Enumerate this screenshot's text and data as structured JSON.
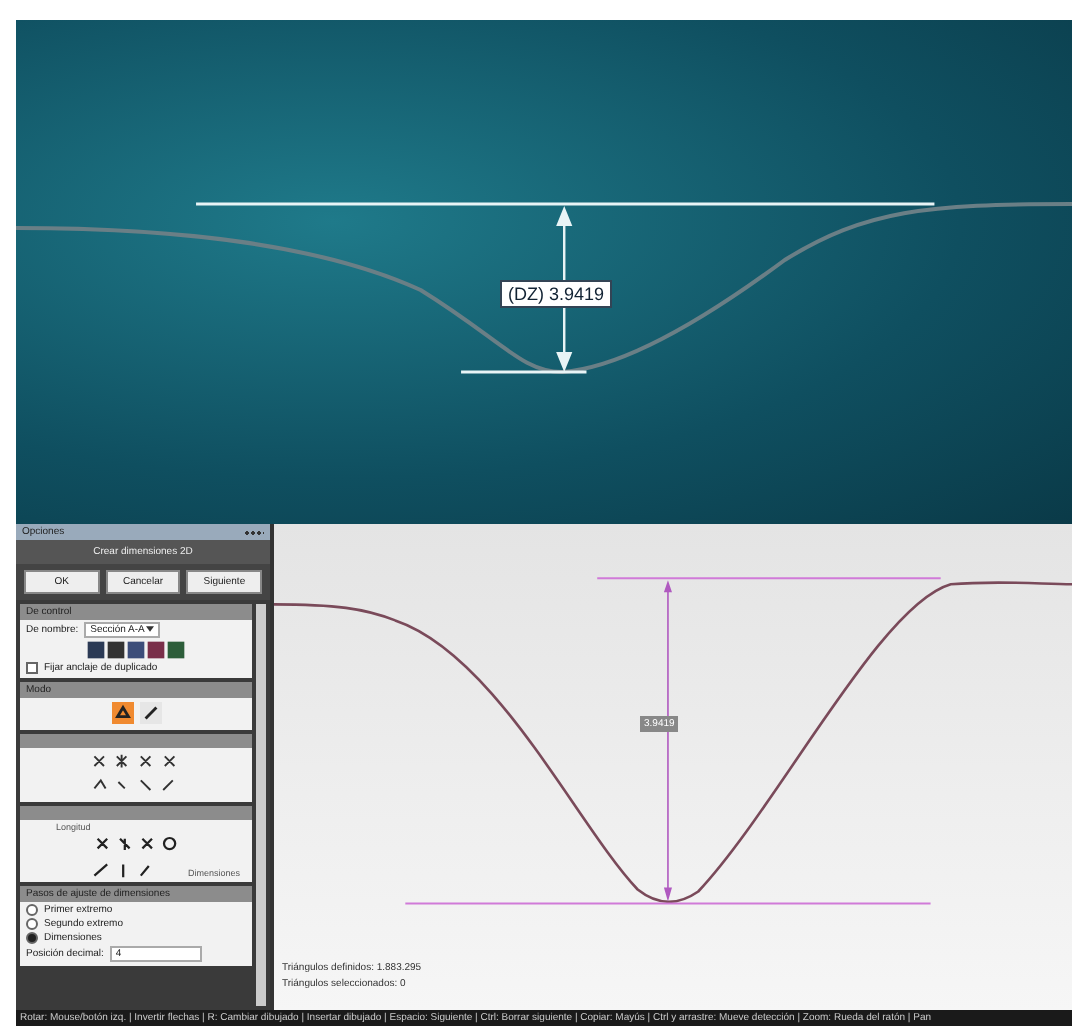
{
  "viewport_3d": {
    "dimension_label": "(DZ) 3.9419"
  },
  "side_panel": {
    "title": "Opciones",
    "header": "Crear dimensiones 2D",
    "buttons": [
      "OK",
      "Cancelar",
      "Siguiente"
    ],
    "sections": [
      {
        "kind": "control",
        "title": "De control",
        "field_label": "De nombre:",
        "field_value": "Sección A-A",
        "checkbox_label": "Fijar anclaje de duplicado",
        "checked": false
      },
      {
        "kind": "mode",
        "title": "Modo",
        "modes": [
          {
            "selected": true
          },
          {
            "selected": false
          }
        ]
      },
      {
        "kind": "tools"
      },
      {
        "kind": "types",
        "labels": [
          "Longitud",
          "Dimensiones"
        ]
      },
      {
        "kind": "steps",
        "title": "Pasos de ajuste de dimensiones",
        "options": [
          {
            "label": "Primer extremo",
            "selected": false
          },
          {
            "label": "Segundo extremo",
            "selected": false
          },
          {
            "label": "Dimensiones",
            "selected": true
          }
        ],
        "decimal_label": "Posición decimal:",
        "decimal_value": "4"
      }
    ]
  },
  "viewport_2d": {
    "dimension_label": "3.9419",
    "info": [
      "Triángulos definidos: 1.883.295",
      "Triángulos seleccionados: 0"
    ]
  },
  "status_bar": "Rotar: Mouse/botón izq. | Invertir flechas | R: Cambiar dibujado | Insertar dibujado | Espacio: Siguiente | Ctrl: Borrar siguiente | Copiar: Mayús | Ctrl y arrastre: Mueve detección | Zoom: Rueda del ratón | Pan"
}
